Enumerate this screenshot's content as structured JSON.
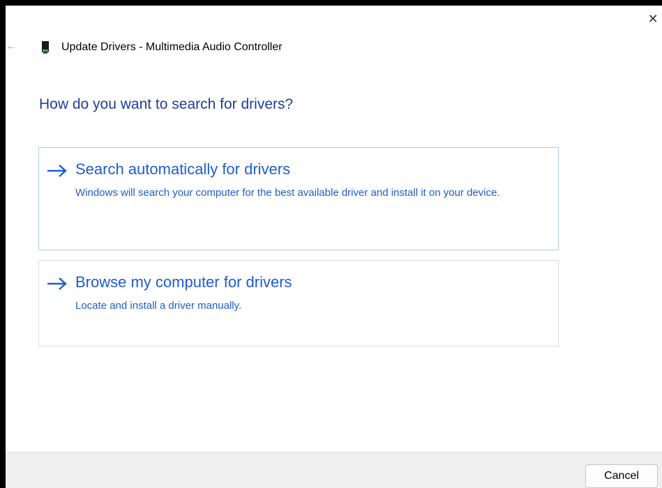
{
  "window": {
    "title": "Update Drivers - Multimedia Audio Controller",
    "close_glyph": "✕",
    "back_glyph": "←"
  },
  "main": {
    "heading": "How do you want to search for drivers?",
    "options": [
      {
        "title": "Search automatically for drivers",
        "description": "Windows will search your computer for the best available driver and install it on your device.",
        "icon": "arrow-right-icon"
      },
      {
        "title": "Browse my computer for drivers",
        "description": "Locate and install a driver manually.",
        "icon": "arrow-right-icon"
      }
    ]
  },
  "footer": {
    "cancel_label": "Cancel"
  },
  "colors": {
    "heading": "#1c3e9e",
    "link": "#1f5ccf",
    "footer_bg": "#f0f0f0"
  }
}
